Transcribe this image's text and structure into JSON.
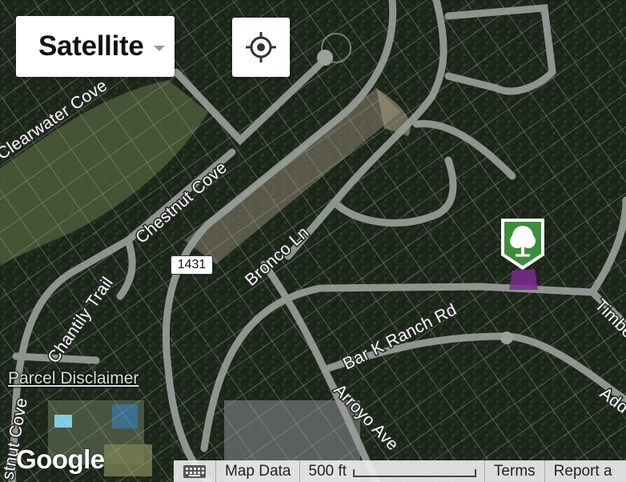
{
  "map": {
    "type_selector_label": "Satellite",
    "highway_shield": "1431",
    "parcel_disclaimer": "Parcel Disclaimer",
    "google_logo": "Google",
    "roads": {
      "clearwater": "Clearwater Cove",
      "chestnut": "Chestnut Cove",
      "chantily": "Chantily Trail",
      "bronco": "Bronco Ln",
      "bark": "Bar K Ranch Rd",
      "arroyo": "Arroyo Ave",
      "timber": "Timbe",
      "add": "Add",
      "chestnut_edge": "stnut Cove"
    },
    "marker_color": "#3c8f3a",
    "parcel_color": "#7a2a8f"
  },
  "footer": {
    "keyboard_icon": "keyboard-icon",
    "map_data": "Map Data",
    "scale_label": "500 ft",
    "terms": "Terms",
    "report": "Report a"
  },
  "icons": {
    "locate": "crosshair-icon",
    "caret": "chevron-down-icon",
    "marker": "tree-marker-icon"
  }
}
